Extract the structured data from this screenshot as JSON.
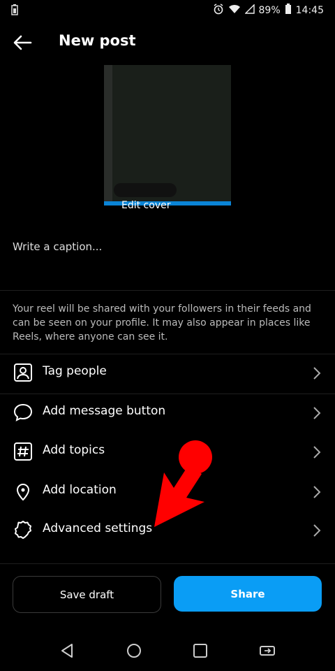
{
  "status": {
    "battery": "89%",
    "time": "14:45"
  },
  "header": {
    "title": "New post"
  },
  "cover": {
    "edit_label": "Edit cover"
  },
  "caption": {
    "placeholder": "Write a caption..."
  },
  "info_text": "Your reel will be shared with your followers in their feeds and can be seen on your profile. It may also appear in places like Reels, where anyone can see it.",
  "options": [
    {
      "label": "Tag people",
      "icon": "tag-people-icon"
    },
    {
      "label": "Add message button",
      "icon": "message-bubble-icon"
    },
    {
      "label": "Add topics",
      "icon": "hashtag-icon"
    },
    {
      "label": "Add location",
      "icon": "location-pin-icon"
    },
    {
      "label": "Advanced settings",
      "icon": "gear-icon"
    }
  ],
  "buttons": {
    "save_draft": "Save draft",
    "share": "Share"
  },
  "colors": {
    "accent": "#0a9df5",
    "annotation": "#ff0000"
  }
}
